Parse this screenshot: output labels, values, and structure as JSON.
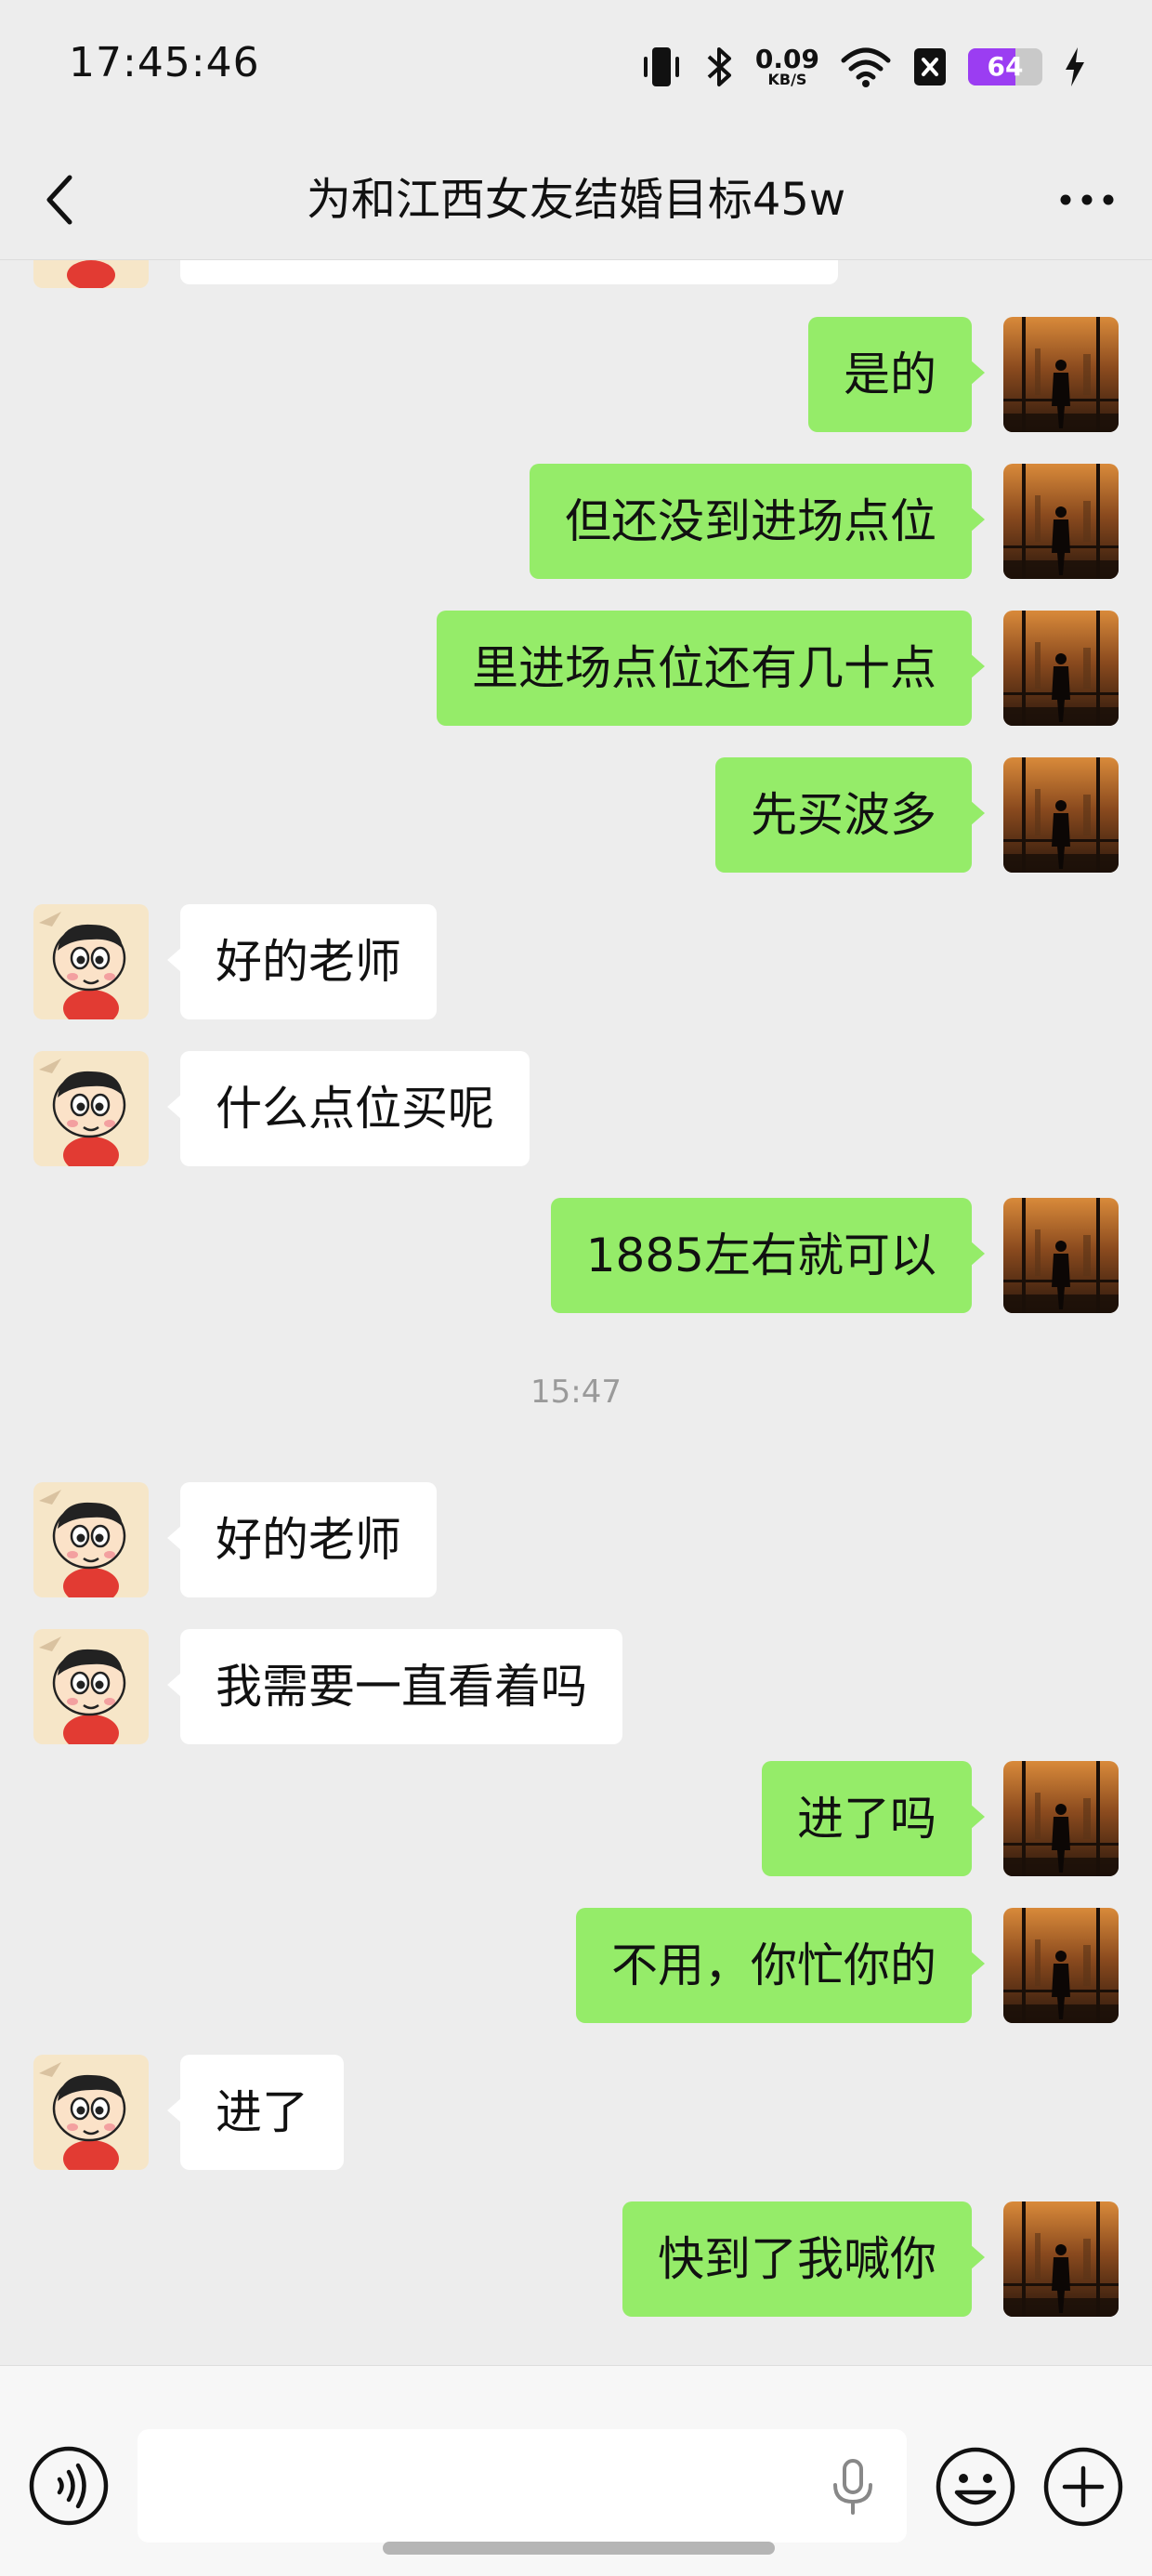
{
  "status_bar": {
    "time": "17:45:46",
    "net_speed": "0.09",
    "net_unit": "KB/S",
    "battery": "64",
    "battery_level": 0.64
  },
  "header": {
    "title": "为和江西女友结婚目标45w"
  },
  "messages": [
    {
      "side": "out",
      "text": "是的"
    },
    {
      "side": "out",
      "text": "但还没到进场点位"
    },
    {
      "side": "out",
      "text": "里进场点位还有几十点"
    },
    {
      "side": "out",
      "text": "先买波多"
    },
    {
      "side": "in",
      "text": "好的老师"
    },
    {
      "side": "in",
      "text": "什么点位买呢"
    },
    {
      "side": "out",
      "text": "1885左右就可以"
    },
    {
      "side": "in",
      "text": "好的老师"
    },
    {
      "side": "in",
      "text": "我需要一直看着吗"
    },
    {
      "side": "out",
      "text": "进了吗"
    },
    {
      "side": "out",
      "text": "不用，你忙你的"
    },
    {
      "side": "in",
      "text": "进了"
    },
    {
      "side": "out",
      "text": "快到了我喊你"
    }
  ],
  "timestamp": "15:47",
  "input": {
    "value": "",
    "placeholder": ""
  },
  "colors": {
    "background": "#ededed",
    "outgoing_bubble": "#95ec69",
    "incoming_bubble": "#ffffff",
    "battery_accent": "#9b3df2"
  }
}
